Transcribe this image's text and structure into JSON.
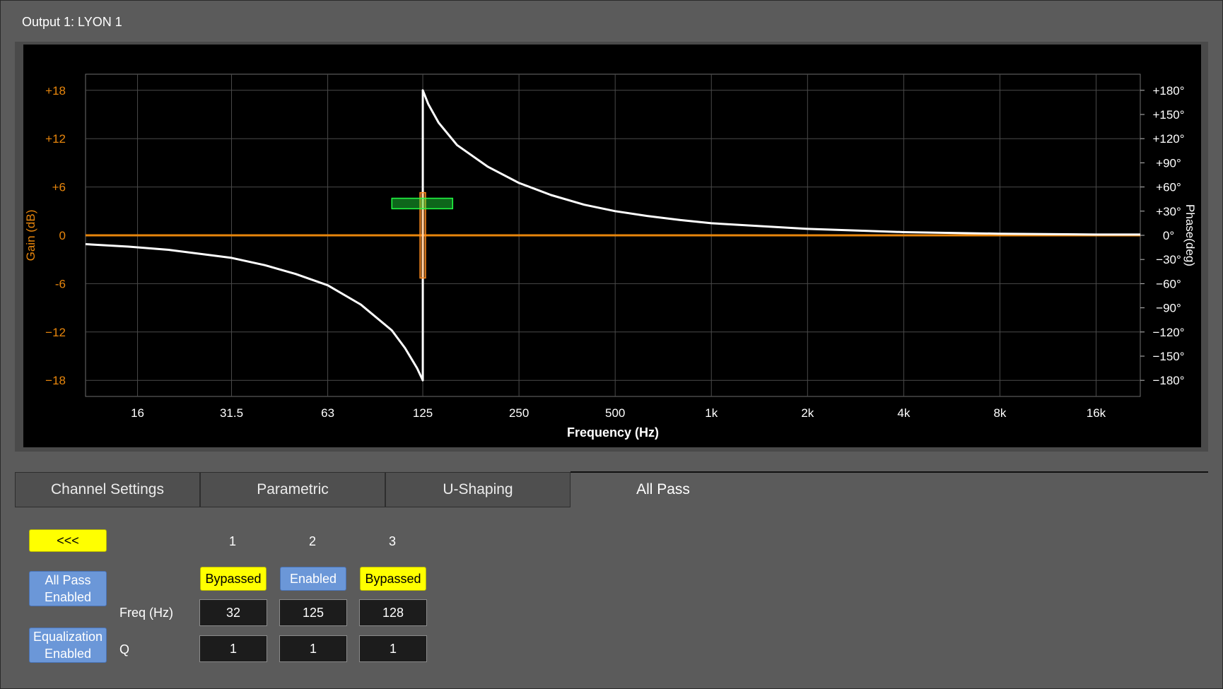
{
  "window": {
    "title": "Output 1: LYON 1"
  },
  "chart_data": {
    "type": "line",
    "xlabel": "Frequency (Hz)",
    "ylabel": "Gain (dB)",
    "y2label": "Phase(deg)",
    "x_scale": "log",
    "xlim": [
      11,
      22000
    ],
    "ylim": [
      -20,
      20
    ],
    "y2lim": [
      -200,
      200
    ],
    "x_ticks": [
      {
        "value": 16,
        "label": "16"
      },
      {
        "value": 31.5,
        "label": "31.5"
      },
      {
        "value": 63,
        "label": "63"
      },
      {
        "value": 125,
        "label": "125"
      },
      {
        "value": 250,
        "label": "250"
      },
      {
        "value": 500,
        "label": "500"
      },
      {
        "value": 1000,
        "label": "1k"
      },
      {
        "value": 2000,
        "label": "2k"
      },
      {
        "value": 4000,
        "label": "4k"
      },
      {
        "value": 8000,
        "label": "8k"
      },
      {
        "value": 16000,
        "label": "16k"
      }
    ],
    "y_ticks": [
      {
        "value": 18,
        "label": "+18"
      },
      {
        "value": 12,
        "label": "+12"
      },
      {
        "value": 6,
        "label": "+6"
      },
      {
        "value": 0,
        "label": "0"
      },
      {
        "value": -6,
        "label": "-6"
      },
      {
        "value": -12,
        "label": "−12"
      },
      {
        "value": -18,
        "label": "−18"
      }
    ],
    "y2_ticks": [
      {
        "value": 180,
        "label": "+180°"
      },
      {
        "value": 150,
        "label": "+150°"
      },
      {
        "value": 120,
        "label": "+120°"
      },
      {
        "value": 90,
        "label": "+90°"
      },
      {
        "value": 60,
        "label": "+60°"
      },
      {
        "value": 30,
        "label": "+30°"
      },
      {
        "value": 0,
        "label": "0°"
      },
      {
        "value": -30,
        "label": "−30°"
      },
      {
        "value": -60,
        "label": "−60°"
      },
      {
        "value": -90,
        "label": "−90°"
      },
      {
        "value": -120,
        "label": "−120°"
      },
      {
        "value": -150,
        "label": "−150°"
      },
      {
        "value": -180,
        "label": "−180°"
      }
    ],
    "grid": true,
    "gain_color": "#e8860c",
    "phase_color": "#ffffff",
    "series": [
      {
        "axis": "gain",
        "x": [
          11,
          22000
        ],
        "y": [
          0,
          0
        ]
      },
      {
        "axis": "phase",
        "x": [
          11,
          15,
          20,
          31.5,
          40,
          50,
          63,
          80,
          100,
          110,
          120,
          125,
          125,
          130,
          140,
          160,
          200,
          250,
          315,
          400,
          500,
          630,
          800,
          1000,
          2000,
          4000,
          8000,
          16000,
          22000
        ],
        "y": [
          -11,
          -14,
          -18,
          -28,
          -37,
          -48,
          -62,
          -86,
          -118,
          -140,
          -165,
          -180,
          180,
          163,
          140,
          112,
          85,
          65,
          50,
          38,
          30,
          24,
          19,
          15,
          8,
          4,
          2,
          1,
          1
        ]
      }
    ],
    "markers": [
      {
        "name": "band-2-frequency-marker",
        "color": "#ff8a1c",
        "x_center": 125,
        "x_span": [
          122.5,
          127.5
        ],
        "y_span": [
          -5.3,
          5.3
        ]
      },
      {
        "name": "band-2-q-marker",
        "color": "#22ff44",
        "x_center": 125,
        "x_span": [
          100,
          155
        ],
        "y_span": [
          3.3,
          4.6
        ]
      }
    ]
  },
  "tabs": [
    {
      "label": "Channel Settings"
    },
    {
      "label": "Parametric"
    },
    {
      "label": "U-Shaping"
    },
    {
      "label": "All Pass",
      "active": true
    }
  ],
  "controls": {
    "back_label": "<<<",
    "all_pass_label": "All Pass Enabled",
    "equalization_label": "Equalization Enabled"
  },
  "bands": {
    "freq_label": "Freq (Hz)",
    "q_label": "Q",
    "items": [
      {
        "number": "1",
        "state": "Bypassed",
        "freq": "32",
        "q": "1"
      },
      {
        "number": "2",
        "state": "Enabled",
        "freq": "125",
        "q": "1"
      },
      {
        "number": "3",
        "state": "Bypassed",
        "freq": "128",
        "q": "1"
      }
    ]
  },
  "colors": {
    "bypassed": "#ffff00",
    "enabled": "#6b97d8"
  }
}
